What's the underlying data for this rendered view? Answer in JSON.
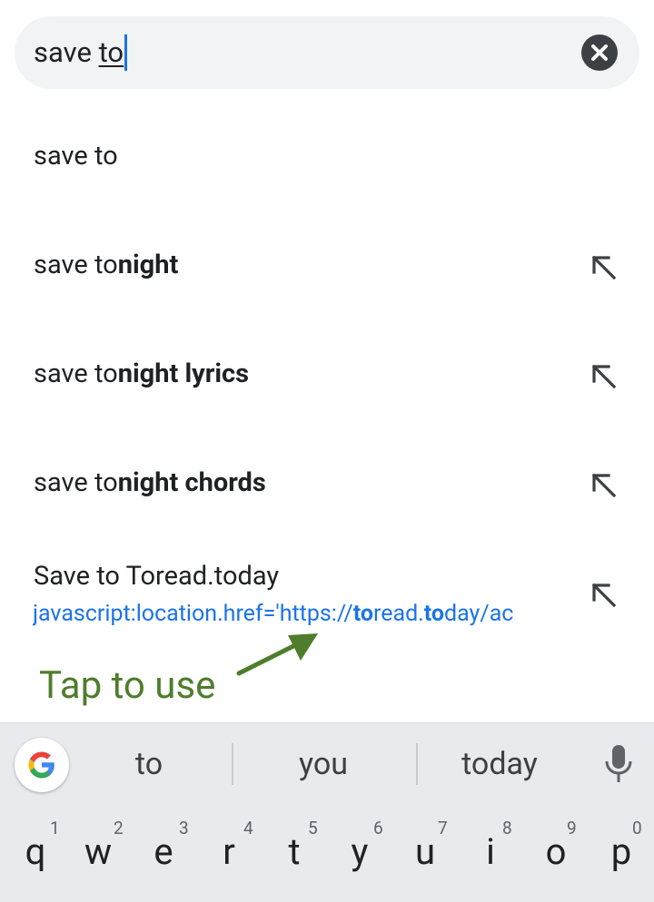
{
  "search": {
    "prefix": "save ",
    "typed": "to"
  },
  "suggestions": [
    {
      "normal": "save to",
      "bold": ""
    },
    {
      "normal": "save to",
      "bold": "night"
    },
    {
      "normal": "save to",
      "bold": "night lyrics"
    },
    {
      "normal": "save to",
      "bold": "night chords"
    }
  ],
  "bookmark": {
    "title": "Save to Toread.today",
    "url_a": "javascript:location.href='https://",
    "url_b": "to",
    "url_c": "read.",
    "url_d": "to",
    "url_e": "day/ac"
  },
  "annotation": {
    "label": "Tap to use",
    "color": "#4f7d2c"
  },
  "keyboard": {
    "chips": [
      "to",
      "you",
      "today"
    ],
    "keys": [
      {
        "letter": "q",
        "num": "1"
      },
      {
        "letter": "w",
        "num": "2"
      },
      {
        "letter": "e",
        "num": "3"
      },
      {
        "letter": "r",
        "num": "4"
      },
      {
        "letter": "t",
        "num": "5"
      },
      {
        "letter": "y",
        "num": "6"
      },
      {
        "letter": "u",
        "num": "7"
      },
      {
        "letter": "i",
        "num": "8"
      },
      {
        "letter": "o",
        "num": "9"
      },
      {
        "letter": "p",
        "num": "0"
      }
    ]
  },
  "icons": {
    "clear": "clear-icon",
    "fill_up": "arrow-up-left-icon",
    "google": "google-g-icon",
    "mic": "microphone-icon"
  },
  "colors": {
    "link": "#1a73e8",
    "cursor": "#1a73e8"
  }
}
